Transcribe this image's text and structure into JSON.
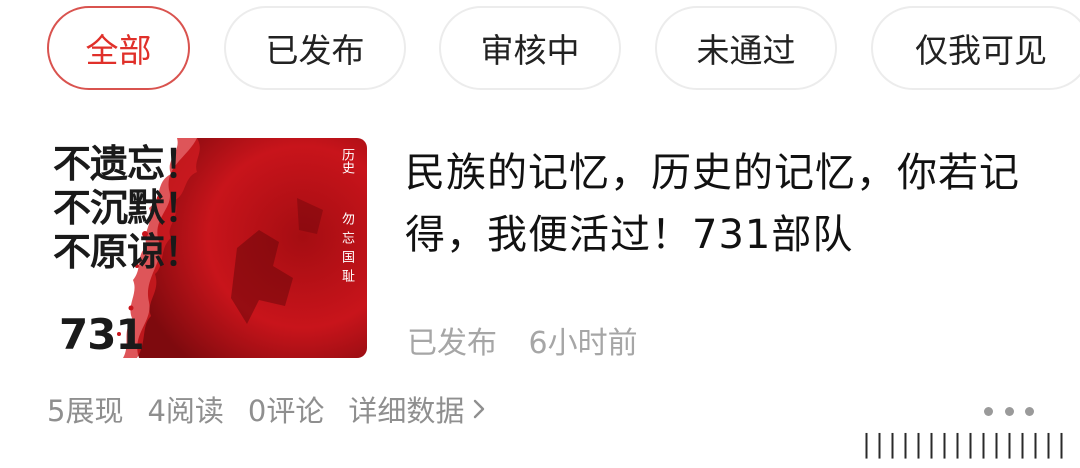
{
  "tabs": [
    {
      "label": "全部",
      "active": true
    },
    {
      "label": "已发布",
      "active": false
    },
    {
      "label": "审核中",
      "active": false
    },
    {
      "label": "未通过",
      "active": false
    },
    {
      "label": "仅我可见",
      "active": false
    }
  ],
  "article": {
    "title": "民族的记忆，历史的记忆，你若记得，我便活过！731部队",
    "status": "已发布",
    "time": "6小时前",
    "thumbnail": {
      "slogan_lines": [
        "不遗忘！",
        "不沉默！",
        "不原谅！"
      ],
      "number": "731",
      "vertical_text_1": "历史",
      "vertical_text_2": "勿忘国耻"
    },
    "stats": {
      "impressions": "5展现",
      "reads": "4阅读",
      "comments": "0评论",
      "detail_link": "详细数据"
    }
  },
  "icons": {
    "detail_chevron": "chevron-right-icon",
    "more": "more-dots-icon"
  },
  "watermark": "∣∣∣∣∣∣∣∣∣∣∣∣∣∣∣∣∣∣∣∣",
  "colors": {
    "accent": "#e0302a",
    "accent_border": "#d9534f",
    "thumb_red": "#c8141b"
  }
}
